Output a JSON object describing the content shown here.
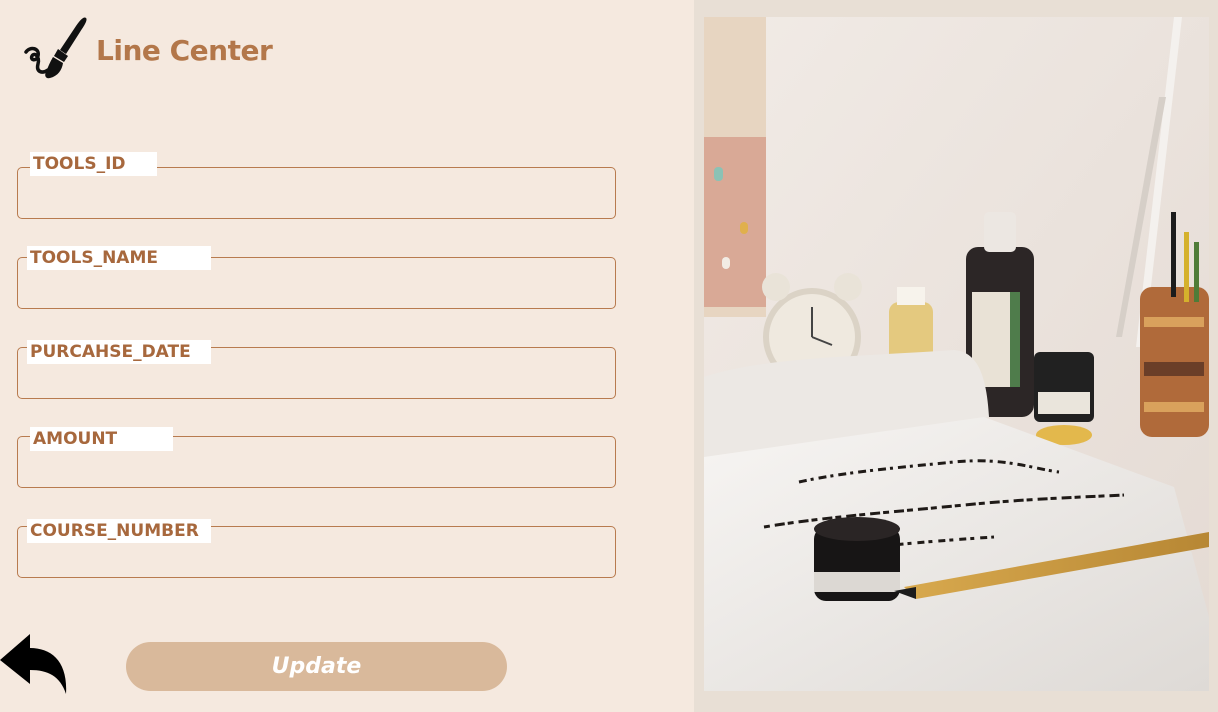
{
  "brand": {
    "title": "Line Center",
    "icon": "brush-icon"
  },
  "form": {
    "fields": [
      {
        "label": "TOOLS_ID",
        "value": ""
      },
      {
        "label": "TOOLS_NAME",
        "value": ""
      },
      {
        "label": "PURCAHSE_DATE",
        "value": ""
      },
      {
        "label": "AMOUNT",
        "value": ""
      },
      {
        "label": "COURSE_NUMBER",
        "value": ""
      }
    ],
    "update_label": "Update",
    "back_icon": "back-arrow-icon"
  },
  "colors": {
    "background": "#f5e9df",
    "accent": "#b3774a",
    "button": "#d9b99b",
    "right_panel": "#e8dfd5"
  }
}
